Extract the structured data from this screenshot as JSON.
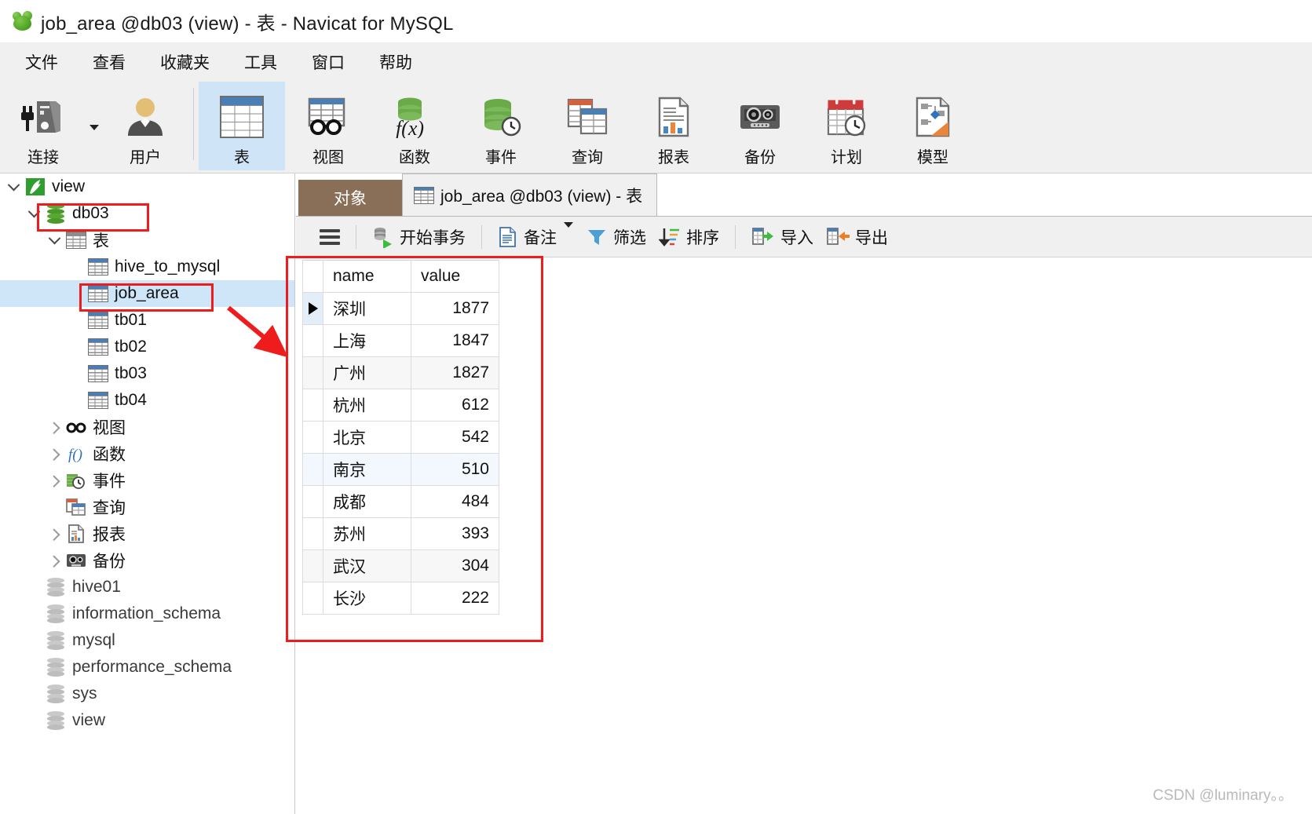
{
  "window": {
    "title": "job_area @db03 (view) - 表 - Navicat for MySQL",
    "logo_name": "navicat-logo"
  },
  "menubar": {
    "items": [
      {
        "label": "文件"
      },
      {
        "label": "查看"
      },
      {
        "label": "收藏夹"
      },
      {
        "label": "工具"
      },
      {
        "label": "窗口"
      },
      {
        "label": "帮助"
      }
    ]
  },
  "ribbon": {
    "buttons": [
      {
        "label": "连接",
        "icon": "connection-icon",
        "selected": false
      },
      {
        "label": "用户",
        "icon": "user-icon",
        "selected": false
      },
      {
        "label": "表",
        "icon": "table-icon",
        "selected": true
      },
      {
        "label": "视图",
        "icon": "view-icon",
        "selected": false
      },
      {
        "label": "函数",
        "icon": "function-icon",
        "selected": false
      },
      {
        "label": "事件",
        "icon": "event-icon",
        "selected": false
      },
      {
        "label": "查询",
        "icon": "query-icon",
        "selected": false
      },
      {
        "label": "报表",
        "icon": "report-icon",
        "selected": false
      },
      {
        "label": "备份",
        "icon": "backup-icon",
        "selected": false
      },
      {
        "label": "计划",
        "icon": "schedule-icon",
        "selected": false
      },
      {
        "label": "模型",
        "icon": "model-icon",
        "selected": false
      }
    ]
  },
  "sidebar": {
    "tree": [
      {
        "label": "view",
        "indent": 0,
        "twisty": "down",
        "icon": "connection-icon",
        "selected": false,
        "dim": false
      },
      {
        "label": "db03",
        "indent": 1,
        "twisty": "down",
        "icon": "database-green-icon",
        "selected": false,
        "dim": false
      },
      {
        "label": "表",
        "indent": 2,
        "twisty": "down",
        "icon": "table-icon",
        "selected": false,
        "dim": false
      },
      {
        "label": "hive_to_mysql",
        "indent": 3,
        "twisty": "none",
        "icon": "table-icon",
        "selected": false,
        "dim": false
      },
      {
        "label": "job_area",
        "indent": 3,
        "twisty": "none",
        "icon": "table-icon",
        "selected": true,
        "dim": false
      },
      {
        "label": "tb01",
        "indent": 3,
        "twisty": "none",
        "icon": "table-icon",
        "selected": false,
        "dim": false
      },
      {
        "label": "tb02",
        "indent": 3,
        "twisty": "none",
        "icon": "table-icon",
        "selected": false,
        "dim": false
      },
      {
        "label": "tb03",
        "indent": 3,
        "twisty": "none",
        "icon": "table-icon",
        "selected": false,
        "dim": false
      },
      {
        "label": "tb04",
        "indent": 3,
        "twisty": "none",
        "icon": "table-icon",
        "selected": false,
        "dim": false
      },
      {
        "label": "视图",
        "indent": 2,
        "twisty": "right",
        "icon": "view-icon",
        "selected": false,
        "dim": false
      },
      {
        "label": "函数",
        "indent": 2,
        "twisty": "right",
        "icon": "function-icon",
        "selected": false,
        "dim": false
      },
      {
        "label": "事件",
        "indent": 2,
        "twisty": "right",
        "icon": "event-icon",
        "selected": false,
        "dim": false
      },
      {
        "label": "查询",
        "indent": 2,
        "twisty": "none",
        "icon": "query-icon",
        "selected": false,
        "dim": false
      },
      {
        "label": "报表",
        "indent": 2,
        "twisty": "right",
        "icon": "report-icon",
        "selected": false,
        "dim": false
      },
      {
        "label": "备份",
        "indent": 2,
        "twisty": "right",
        "icon": "backup-icon",
        "selected": false,
        "dim": false
      },
      {
        "label": "hive01",
        "indent": 1,
        "twisty": "none",
        "icon": "database-gray-icon",
        "selected": false,
        "dim": true
      },
      {
        "label": "information_schema",
        "indent": 1,
        "twisty": "none",
        "icon": "database-gray-icon",
        "selected": false,
        "dim": true
      },
      {
        "label": "mysql",
        "indent": 1,
        "twisty": "none",
        "icon": "database-gray-icon",
        "selected": false,
        "dim": true
      },
      {
        "label": "performance_schema",
        "indent": 1,
        "twisty": "none",
        "icon": "database-gray-icon",
        "selected": false,
        "dim": true
      },
      {
        "label": "sys",
        "indent": 1,
        "twisty": "none",
        "icon": "database-gray-icon",
        "selected": false,
        "dim": true
      },
      {
        "label": "view",
        "indent": 1,
        "twisty": "none",
        "icon": "database-gray-icon",
        "selected": false,
        "dim": true
      }
    ]
  },
  "tabs": {
    "object_tab": "对象",
    "active_tab": "job_area @db03 (view) - 表"
  },
  "grid_toolbar": {
    "menu_icon": "hamburger-icon",
    "buttons": [
      {
        "label": "开始事务",
        "icon": "begin-transaction-icon",
        "caret": false
      },
      {
        "label": "备注",
        "icon": "note-icon",
        "caret": true
      },
      {
        "label": "筛选",
        "icon": "filter-icon",
        "caret": false
      },
      {
        "label": "排序",
        "icon": "sort-icon",
        "caret": false
      },
      {
        "label": "导入",
        "icon": "import-icon",
        "caret": false
      },
      {
        "label": "导出",
        "icon": "export-icon",
        "caret": false
      }
    ]
  },
  "data_grid": {
    "columns": [
      "name",
      "value"
    ],
    "selected_column": "name",
    "current_row_index": 0,
    "rows": [
      {
        "name": "深圳",
        "value": "1877"
      },
      {
        "name": "上海",
        "value": "1847"
      },
      {
        "name": "广州",
        "value": "1827"
      },
      {
        "name": "杭州",
        "value": "612"
      },
      {
        "name": "北京",
        "value": "542"
      },
      {
        "name": "南京",
        "value": "510"
      },
      {
        "name": "成都",
        "value": "484"
      },
      {
        "name": "苏州",
        "value": "393"
      },
      {
        "name": "武汉",
        "value": "304"
      },
      {
        "name": "长沙",
        "value": "222"
      }
    ]
  },
  "annotations": {
    "color": "#ee1c1c",
    "boxes": [
      "db03-tree-item",
      "job_area-tree-item",
      "data-grid"
    ],
    "arrow": "job-area-to-grid-arrow"
  },
  "watermark": {
    "text": "CSDN @luminary。。"
  }
}
